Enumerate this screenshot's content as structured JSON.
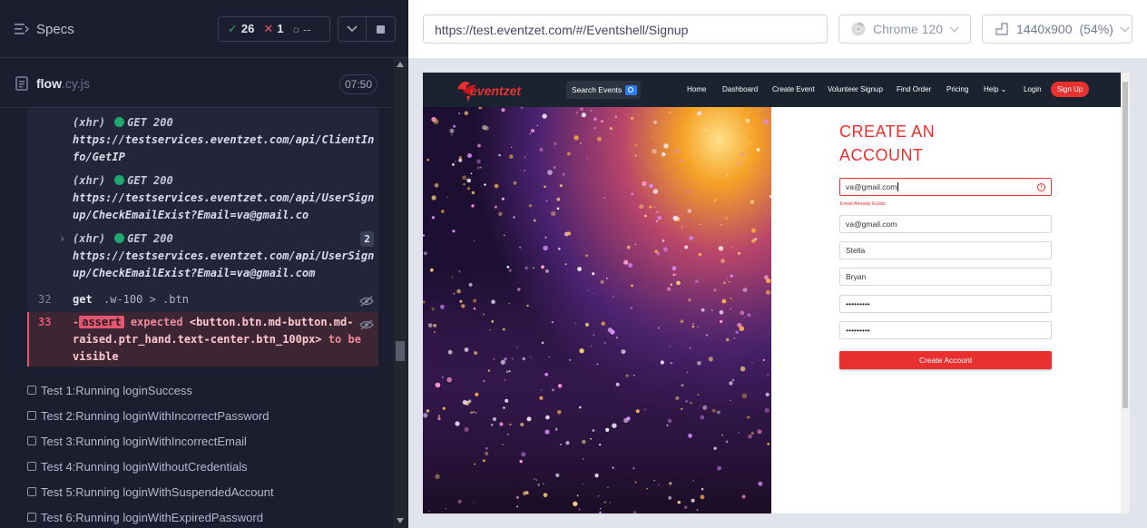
{
  "reporter": {
    "title": "Specs",
    "stats": {
      "passed": "26",
      "failed": "1",
      "pending": "--"
    },
    "spec_file": {
      "name": "flow",
      "ext": ".cy.js",
      "duration": "07:50"
    },
    "commands": [
      {
        "type": "(xhr)",
        "method": "GET 200",
        "url": "https://testservices.eventzet.com/api/ClientInfo/GetIP"
      },
      {
        "type": "(xhr)",
        "method": "GET 200",
        "url": "https://testservices.eventzet.com/api/UserSignup/CheckEmailExist?Email=va@gmail.co"
      },
      {
        "type": "(xhr)",
        "method": "GET 200",
        "url": "https://testservices.eventzet.com/api/UserSignup/CheckEmailExist?Email=va@gmail.com",
        "count": "2"
      }
    ],
    "cmd32": {
      "num": "32",
      "name": "get",
      "message": ".w-100 > .btn"
    },
    "cmd33": {
      "num": "33",
      "prefix": "-",
      "tag": "assert",
      "expected": "expected",
      "selector": "<button.btn.md-button.md-raised.ptr_hand.text-center.btn_100px>",
      "to": "to",
      "be": "be",
      "visible": "visible"
    },
    "tests": [
      "Test 1:Running loginSuccess",
      "Test 2:Running loginWithIncorrectPassword",
      "Test 3:Running loginWithIncorrectEmail",
      "Test 4:Running loginWithoutCredentials",
      "Test 5:Running loginWithSuspendedAccount",
      "Test 6:Running loginWithExpiredPassword"
    ]
  },
  "aut": {
    "url": "https://test.eventzet.com/#/Eventshell/Signup",
    "browser": "Chrome 120",
    "viewport": "1440x900",
    "scale": "(54%)"
  },
  "app": {
    "logo_text": "eventzet",
    "search_label": "Search Events",
    "nav": [
      "Home",
      "Dashboard",
      "Create Event",
      "Volunteer Signup",
      "Find Order",
      "Pricing",
      "Help",
      "Login"
    ],
    "signup_label": "Sign Up",
    "form": {
      "title": "CREATE AN ACCOUNT",
      "email_value": "va@gmail.com",
      "error_text": "Email Already Exists",
      "confirm_email_value": "va@gmail.com",
      "first_name_value": "Stella",
      "last_name_value": "Bryan",
      "password_value": "•••••••••",
      "confirm_password_value": "•••••••••",
      "submit_label": "Create Account"
    }
  },
  "colors": {
    "pass": "#1fa971",
    "fail": "#e45770",
    "brand_red": "#e8312f"
  }
}
